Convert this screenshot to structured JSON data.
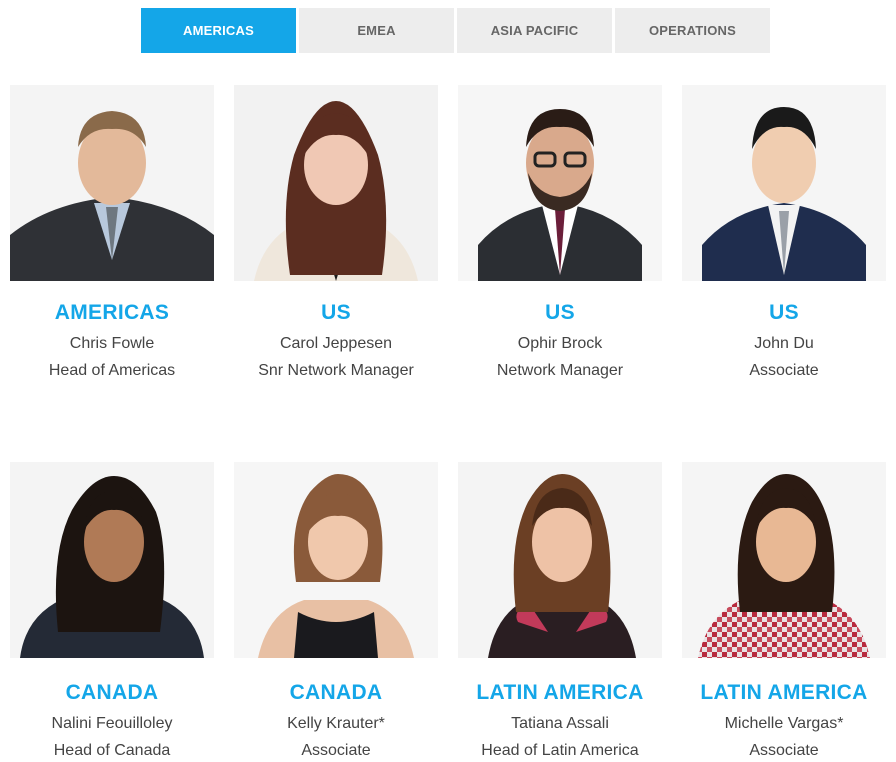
{
  "tabs": [
    {
      "label": "AMERICAS",
      "active": true
    },
    {
      "label": "EMEA",
      "active": false
    },
    {
      "label": "ASIA PACIFIC",
      "active": false
    },
    {
      "label": "OPERATIONS",
      "active": false
    }
  ],
  "team": [
    {
      "region": "AMERICAS",
      "name": "Chris Fowle",
      "role": "Head of Americas"
    },
    {
      "region": "US",
      "name": "Carol Jeppesen",
      "role": "Snr Network Manager"
    },
    {
      "region": "US",
      "name": "Ophir Brock",
      "role": "Network Manager"
    },
    {
      "region": "US",
      "name": "John Du",
      "role": "Associate"
    },
    {
      "region": "CANADA",
      "name": "Nalini Feouilloley",
      "role": "Head of Canada"
    },
    {
      "region": "CANADA",
      "name": "Kelly Krauter*",
      "role": "Associate"
    },
    {
      "region": "LATIN AMERICA",
      "name": "Tatiana Assali",
      "role": "Head of Latin America"
    },
    {
      "region": "LATIN AMERICA",
      "name": "Michelle Vargas*",
      "role": "Associate"
    }
  ],
  "colors": {
    "accent": "#14a6e8",
    "tab_bg": "#ededed",
    "text": "#444444"
  }
}
